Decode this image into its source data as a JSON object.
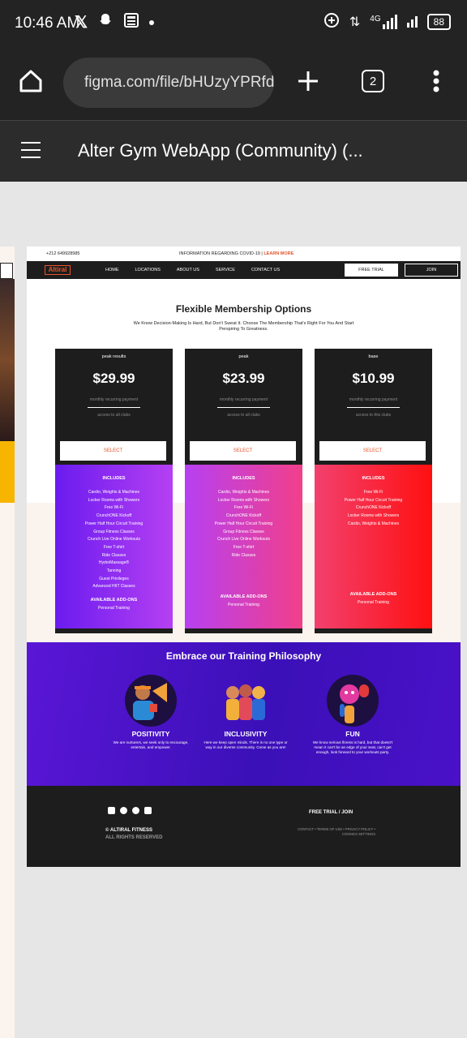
{
  "status_bar": {
    "time": "10:46 AM",
    "battery": "88",
    "network": "4G"
  },
  "browser": {
    "url": "figma.com/file/bHUzyYPRfdlMzI",
    "tab_count": "2"
  },
  "figma": {
    "title": "Alter Gym WebApp (Community) (..."
  },
  "site": {
    "phone": "+212 649928985",
    "covid_text": "INFORMATION REGARDING COVID-19 | ",
    "covid_link": "LEARN MORE",
    "logo": "Altiral",
    "nav": [
      "HOME",
      "LOCATIONS",
      "ABOUT US",
      "SERVICE",
      "CONTACT US"
    ],
    "free_trial": "FREE TRIAL",
    "join": "JOIN",
    "heading": "Flexible Membership Options",
    "subheading": "We Know Decision-Making Is Hard, But Don't Sweat It. Choose The Membership That's Right For You And Start Perspiring To Greatness.",
    "plans": [
      {
        "name": "peak results",
        "price": "$29.99",
        "recurring": "monthly recurring payment",
        "access": "access to all clubs",
        "select": "SELECT",
        "includes": "INCLUDES",
        "features": [
          "Cardio, Weights & Machines",
          "Locker Rooms with Showers",
          "Free Wi-Fi",
          "CrunchONE Kickoff",
          "Power Half Hour Circuit Training",
          "Group Fitness Classes",
          "Crunch Live Online Workouts",
          "Free T-shirt",
          "Ride Classes",
          "HydroMassage®",
          "Tanning",
          "Guest Privileges",
          "Advanced HIIT Classes"
        ],
        "addons_title": "AVAILABLE ADD-ONS",
        "addons": "Personal Training",
        "gradient": [
          "#6a1bf0",
          "#b640f2"
        ]
      },
      {
        "name": "peak",
        "price": "$23.99",
        "recurring": "monthly recurring payment",
        "access": "access to all clubs",
        "select": "SELECT",
        "includes": "INCLUDES",
        "features": [
          "Cardio, Weights & Machines",
          "Locker Rooms with Showers",
          "Free Wi-Fi",
          "CrunchONE Kickoff",
          "Power Half Hour Circuit Training",
          "Group Fitness Classes",
          "Crunch Live Online Workouts",
          "Free T-shirt",
          "Ride Classes"
        ],
        "addons_title": "AVAILABLE ADD-ONS",
        "addons": "Personal Training",
        "gradient": [
          "#b640f2",
          "#f23f8a"
        ]
      },
      {
        "name": "base",
        "price": "$10.99",
        "recurring": "monthly recurring payment",
        "access": "access to this clubs",
        "select": "SELECT",
        "includes": "INCLUDES",
        "features": [
          "Free Wi-Fi",
          "Power Half Hour Circuit Training",
          "CrunchONE Kickoff",
          "Locker Rooms with Showers",
          "Cardio, Weights & Machines"
        ],
        "addons_title": "AVAILABLE ADD-ONS",
        "addons": "Personal Training",
        "gradient": [
          "#f2406e",
          "#ff1010"
        ]
      }
    ],
    "philosophy": {
      "title": "Embrace our Training Philosophy",
      "items": [
        {
          "label": "POSITIVITY",
          "text": "We are nurturers, we seek only to encourage, entertain, and empower."
        },
        {
          "label": "INCLUSIVITY",
          "text": "Here we keep open minds. There is no one type or way in our diverse community. Come as you are!"
        },
        {
          "label": "FUN",
          "text": "We know serious fitness is hard, but that doesn't mean it can't be an edge of your seat, can't get enough, look forward to your workouts party."
        }
      ]
    },
    "footer": {
      "copyright": "© ALTIRAL FITNESS",
      "rights": "ALL RIGHTS RESERVED",
      "free_trial_join": "FREE TRIAL / JOIN",
      "links": "CONTACT • TERMS OF USE • PRIVACY POLICY • COOKIES SETTINGS"
    }
  }
}
